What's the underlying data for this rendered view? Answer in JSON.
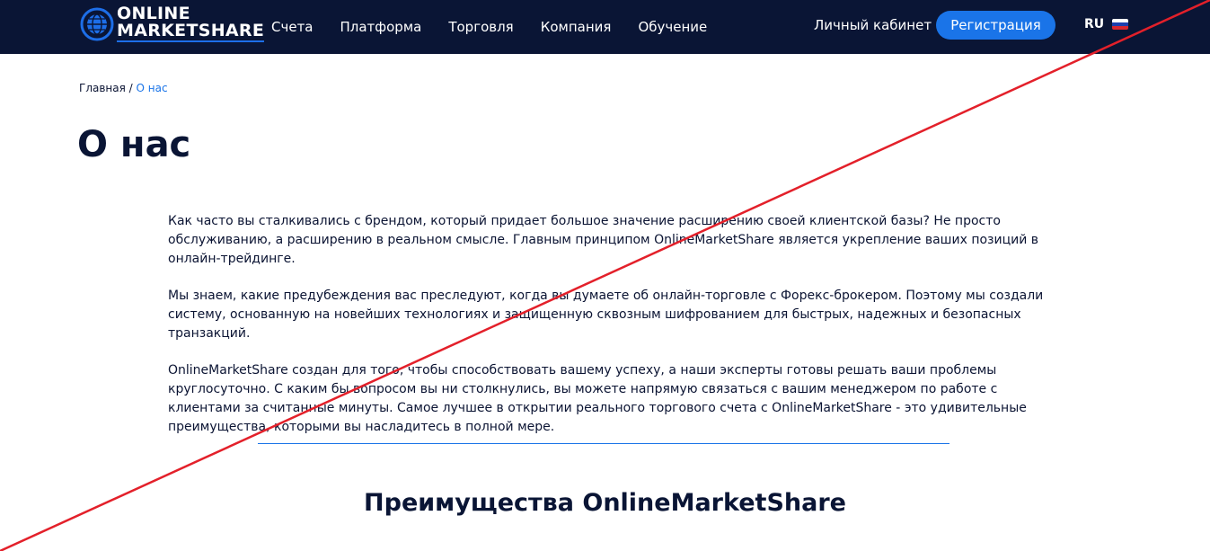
{
  "header": {
    "logo": {
      "line1": "ONLINE",
      "line2": "MARKETSHARE"
    },
    "nav": [
      "Счета",
      "Платформа",
      "Торговля",
      "Компания",
      "Обучение"
    ],
    "cabinet_label": "Личный кабинет",
    "register_label": "Регистрация",
    "language": "RU"
  },
  "breadcrumb": {
    "home": "Главная",
    "separator": " / ",
    "current": "О нас"
  },
  "page_title": "О нас",
  "paragraphs": [
    "Как часто вы сталкивались с брендом, который придает большое значение расширению своей клиентской базы? Не просто обслуживанию, а расширению в реальном смысле. Главным принципом OnlineMarketShare является укрепление ваших позиций в онлайн-трейдинге.",
    "Мы знаем, какие предубеждения вас преследуют, когда вы думаете об онлайн-торговле с Форекс-брокером. Поэтому мы создали систему, основанную на новейших технологиях и защищенную сквозным шифрованием для быстрых, надежных и безопасных транзакций.",
    "OnlineMarketShare создан для того, чтобы способствовать вашему успеху, а наши эксперты готовы решать ваши проблемы круглосуточно. С каким бы вопросом вы ни столкнулись, вы можете напрямую связаться с вашим менеджером по работе с клиентами за считанные минуты. Самое лучшее в открытии реального торгового счета с OnlineMarketShare - это удивительные преимущества, которыми вы насладитесь в полной мере."
  ],
  "section_title": "Преимущества OnlineMarketShare",
  "colors": {
    "header_bg": "#0a1535",
    "accent": "#1a74e8",
    "strike_line": "#e3202a"
  }
}
